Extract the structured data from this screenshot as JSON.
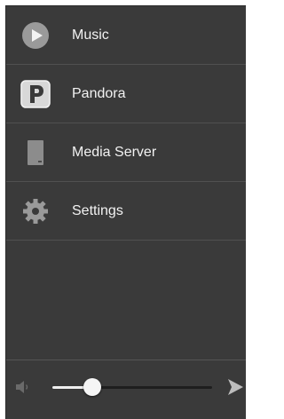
{
  "menu": {
    "items": [
      {
        "label": "Music",
        "icon": "play-circle-icon"
      },
      {
        "label": "Pandora",
        "icon": "pandora-logo-icon"
      },
      {
        "label": "Media Server",
        "icon": "media-server-icon"
      },
      {
        "label": "Settings",
        "icon": "gear-icon"
      }
    ]
  },
  "volume": {
    "level": 0.25,
    "icon": "speaker-icon",
    "send_icon": "send-arrow-icon"
  },
  "colors": {
    "panel_bg": "#3a3a3a",
    "text": "#f2f2f2",
    "divider": "#505050",
    "slider_fill": "#f0f0f0",
    "slider_track": "#1e1e1e"
  }
}
